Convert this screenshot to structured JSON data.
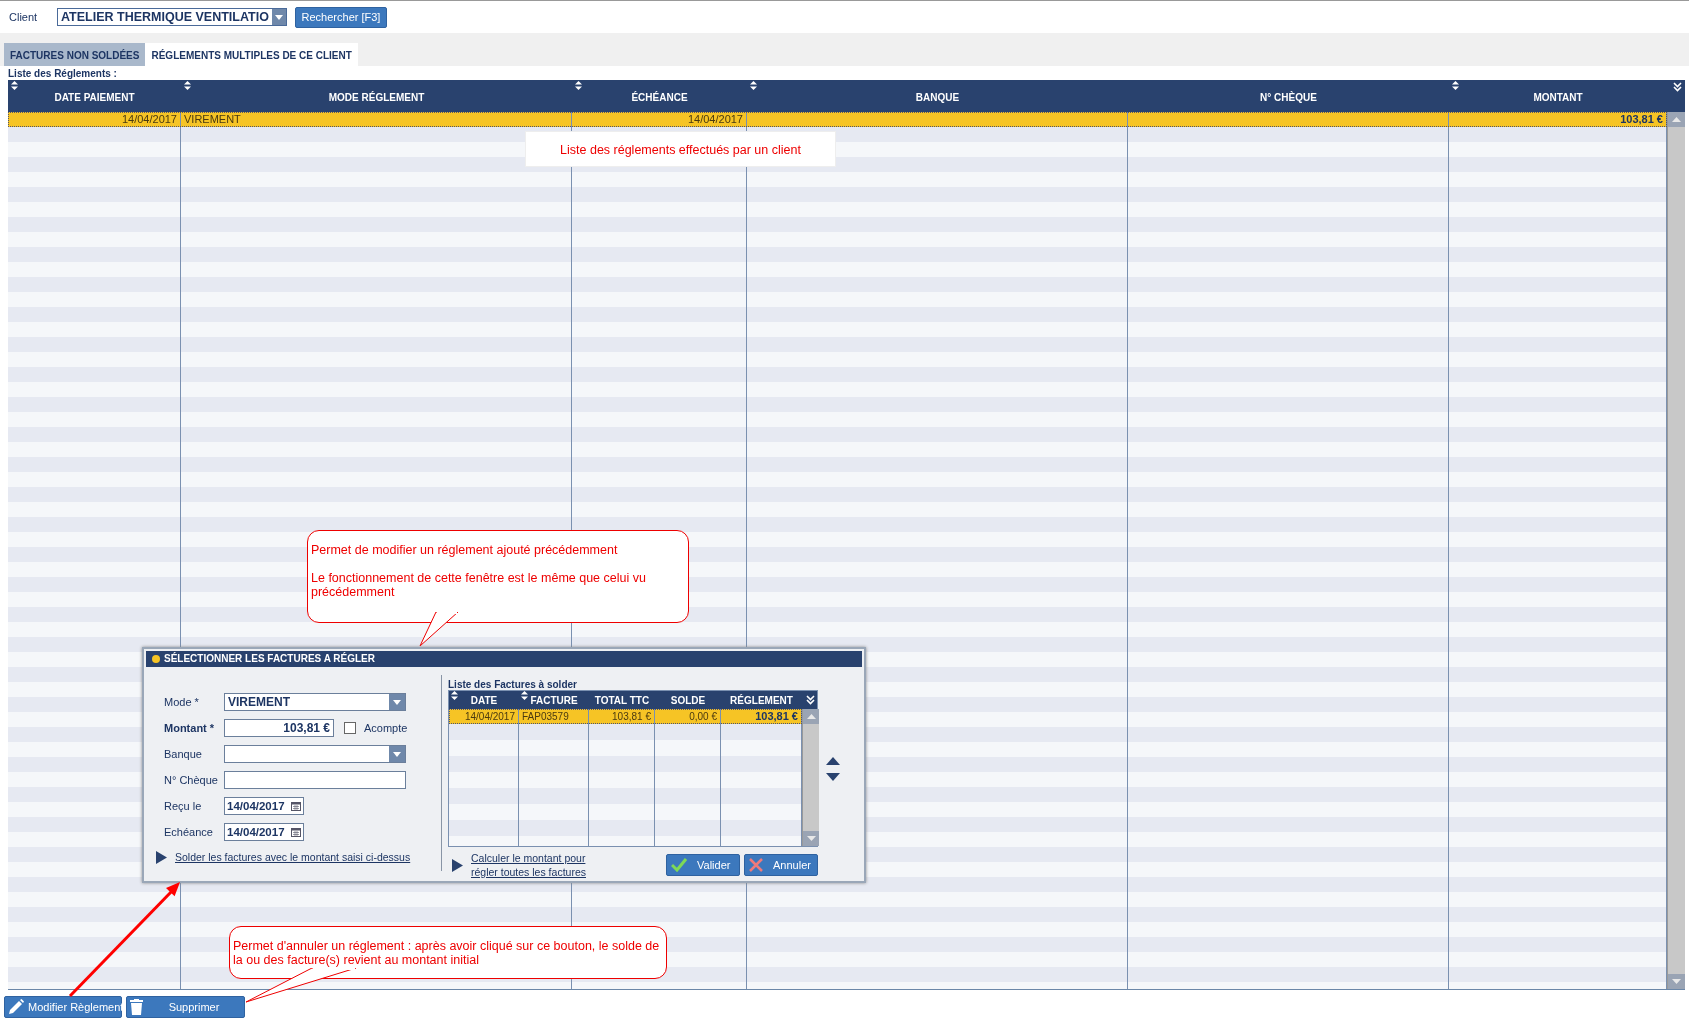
{
  "client": {
    "label": "Client",
    "value": "ATELIER THERMIQUE VENTILATIO"
  },
  "search_button": {
    "label": "Rechercher [F3]"
  },
  "tabs": [
    {
      "label": "FACTURES NON SOLDÉES",
      "selected": false
    },
    {
      "label": "RÉGLEMENTS MULTIPLES DE CE CLIENT",
      "selected": true
    }
  ],
  "payments": {
    "title": "Liste des Réglements :",
    "columns": [
      {
        "label": "DATE PAIEMENT",
        "sortable": true
      },
      {
        "label": "MODE RÉGLEMENT",
        "sortable": true
      },
      {
        "label": "ÉCHÉANCE",
        "sortable": true
      },
      {
        "label": "BANQUE",
        "sortable": true
      },
      {
        "label": "N° CHÈQUE",
        "sortable": false
      },
      {
        "label": "MONTANT",
        "sortable": true
      }
    ],
    "rows": [
      {
        "selected": true,
        "cells": [
          {
            "text": "14/04/2017"
          },
          {
            "text": "VIREMENT"
          },
          {
            "text": "14/04/2017"
          },
          {},
          {},
          {
            "text": "103,81 €"
          }
        ]
      }
    ]
  },
  "tooltip": {
    "text": "Liste des réglements effectués par un client"
  },
  "callouts": [
    {
      "paragraphs": [
        "Permet de modifier un réglement ajouté précédemment",
        "Le fonctionnement de cette fenêtre est le même que celui vu précédemment"
      ]
    },
    {
      "paragraphs": [
        "Permet d'annuler un réglement : après avoir cliqué sur ce bouton, le solde de la ou des facture(s) revient au montant initial"
      ]
    }
  ],
  "dialog": {
    "title": "SÉLECTIONNER LES FACTURES A RÉGLER",
    "fields": [
      {
        "kind": "select",
        "label": "Mode *",
        "value": "VIREMENT",
        "bold": false
      },
      {
        "kind": "amount",
        "label": "Montant *",
        "value": "103,81 €",
        "bold": true,
        "checkbox": {
          "label": "Acompte",
          "checked": false
        }
      },
      {
        "kind": "select",
        "label": "Banque",
        "bold": false
      },
      {
        "kind": "text",
        "label": "N° Chèque",
        "bold": false
      },
      {
        "kind": "date",
        "label": "Reçu le",
        "value": "14/04/2017",
        "bold": false
      },
      {
        "kind": "date",
        "label": "Echéance",
        "value": "14/04/2017",
        "bold": false
      }
    ],
    "settle_link": "Solder les factures avec le montant saisi ci-dessus",
    "invoices": {
      "title": "Liste des Factures à solder",
      "columns": [
        {
          "label": "DATE",
          "sortable": true
        },
        {
          "label": "FACTURE",
          "sortable": true
        },
        {
          "label": "TOTAL TTC",
          "sortable": false
        },
        {
          "label": "SOLDE",
          "sortable": false
        },
        {
          "label": "RÉGLEMENT",
          "sortable": false
        }
      ],
      "rows": [
        {
          "selected": true,
          "cells": [
            "14/04/2017",
            "FAP03579",
            "103,81 €",
            "0,00 €",
            "103,81 €"
          ]
        }
      ]
    },
    "compute_link": "Calculer le montant pour régler toutes les factures",
    "buttons": [
      {
        "kind": "ok",
        "label": "Valider"
      },
      {
        "kind": "cancel",
        "label": "Annuler"
      }
    ]
  },
  "bottom_buttons": [
    {
      "kind": "edit",
      "label": "Modifier Règlement"
    },
    {
      "kind": "delete",
      "label": "Supprimer"
    }
  ]
}
